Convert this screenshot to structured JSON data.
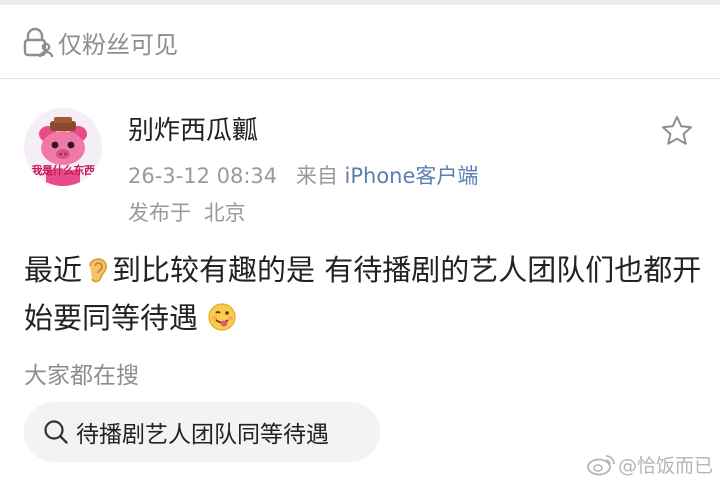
{
  "privacy": {
    "label": "仅粉丝可见",
    "icon": "lock-people-icon"
  },
  "post": {
    "author": "别炸西瓜瓤",
    "avatar_caption": "我是什么东西",
    "timestamp": "26-3-12 08:34",
    "source_prefix": "来自",
    "source": "iPhone客户端",
    "location_prefix": "发布于",
    "location": "北京",
    "text_part1": "最近",
    "ear_emoji": "ear-emoji-icon",
    "text_part2": "到比较有趣的是 有待播剧的艺人团队们也都开始要同等待遇 ",
    "face_emoji": "tongue-face-emoji-icon"
  },
  "trending": {
    "title": "大家都在搜",
    "chip_label": "待播剧艺人团队同等待遇",
    "chip_icon": "search-icon"
  },
  "watermark": {
    "text": "@恰饭而已"
  },
  "colors": {
    "link": "#5b7fb1",
    "meta": "#9a9a9a",
    "text": "#222222",
    "chip_bg": "#f3f3f3"
  }
}
